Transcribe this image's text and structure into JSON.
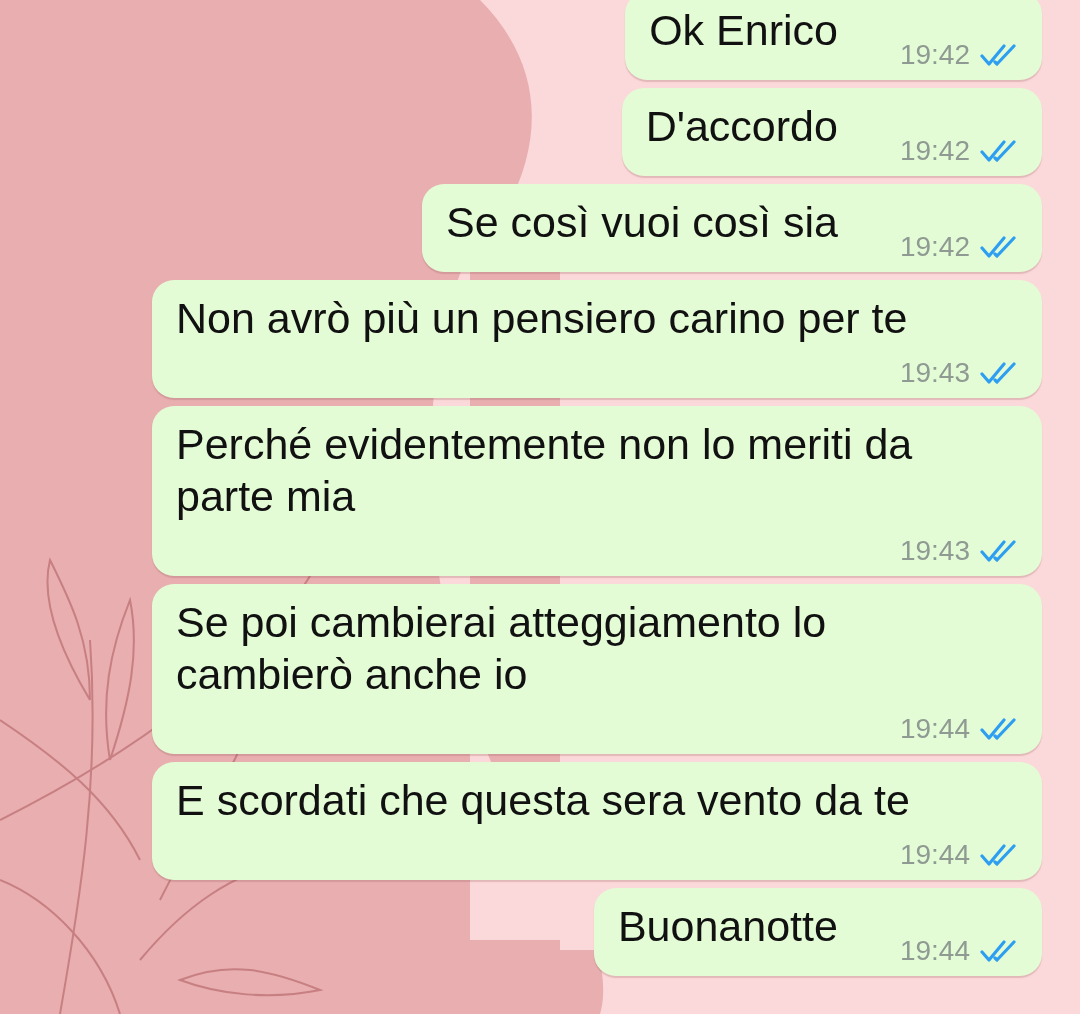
{
  "messages": [
    {
      "text": "Ok Enrico",
      "time": "19:42",
      "read": true
    },
    {
      "text": "D'accordo",
      "time": "19:42",
      "read": true
    },
    {
      "text": "Se così vuoi così sia",
      "time": "19:42",
      "read": true
    },
    {
      "text": "Non avrò più un pensiero carino per te",
      "time": "19:43",
      "read": true
    },
    {
      "text": "Perché evidentemente non lo meriti da parte mia",
      "time": "19:43",
      "read": true
    },
    {
      "text": "Se poi cambierai atteggiamento lo cambierò anche io",
      "time": "19:44",
      "read": true
    },
    {
      "text": "E scordati che questa sera vento da te",
      "time": "19:44",
      "read": true
    },
    {
      "text": "Buonanotte",
      "time": "19:44",
      "read": true
    }
  ]
}
